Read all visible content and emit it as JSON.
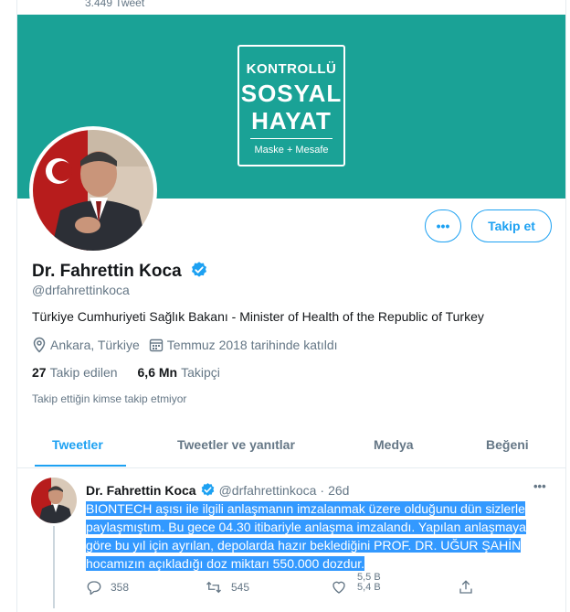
{
  "header": {
    "tweet_count": "3.449 Tweet"
  },
  "banner": {
    "line1": "KONTROLLÜ",
    "line2": "SOSYAL",
    "line3": "HAYAT",
    "line4": "Maske + Mesafe",
    "color": "#1aa296"
  },
  "profile": {
    "name": "Dr. Fahrettin Koca",
    "handle": "@drfahrettinkoca",
    "bio": "Türkiye Cumhuriyeti Sağlık Bakanı - Minister of Health of the Republic of Turkey",
    "location": "Ankara, Türkiye",
    "joined": "Temmuz 2018 tarihinde katıldı",
    "following_count": "27",
    "following_label": "Takip edilen",
    "followers_count": "6,6 Mn",
    "followers_label": "Takipçi",
    "mutual_notice": "Takip ettiğin kimse takip etmiyor"
  },
  "buttons": {
    "more_label": "•••",
    "follow_label": "Takip et"
  },
  "tabs": [
    {
      "label": "Tweetler",
      "active": true
    },
    {
      "label": "Tweetler ve yanıtlar",
      "active": false
    },
    {
      "label": "Medya",
      "active": false
    },
    {
      "label": "Beğeni",
      "active": false
    }
  ],
  "tweet": {
    "name": "Dr. Fahrettin Koca",
    "handle": "@drfahrettinkoca",
    "separator": "·",
    "time": "26d",
    "more": "•••",
    "lines": [
      "BIONTECH aşısı ile ilgili anlaşmanın imzalanmak üzere olduğunu dün sizlerle",
      "paylaşmıştım. Bu gece 04.30 itibariyle anlaşma imzalandı. Yapılan anlaşmaya",
      "göre bu yıl için ayrılan, depolarda hazır beklediğini PROF. DR. UĞUR ŞAHİN",
      "hocamızın açıkladığı doz miktarı 550.000 dozdur."
    ],
    "replies": "358",
    "retweets": "545",
    "likes_partial_1": "5,5 B",
    "likes_partial_2": "5,4 B"
  },
  "colors": {
    "accent": "#1da1f2",
    "muted": "#657786",
    "selection": "#3399ff"
  }
}
